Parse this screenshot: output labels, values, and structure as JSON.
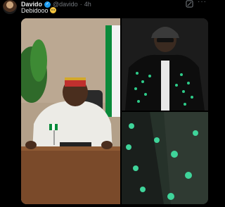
{
  "tweet": {
    "author_name": "Davido",
    "handle": "@davido",
    "separator": "·",
    "time": "4h",
    "text": "Debidooo",
    "emoji": "laughing-crying-emoji"
  },
  "colors": {
    "background": "#000000",
    "text": "#e7e9ea",
    "muted": "#71767b",
    "verified": "#1d9bf0"
  },
  "icons": {
    "verified": "verified-badge-icon",
    "grok": "grok-icon",
    "more": "more-icon"
  },
  "media": {
    "count": 3,
    "items": [
      "man-in-crown-at-desk-with-flag",
      "man-in-cap-and-studded-leather-jacket",
      "closeup-of-green-studded-jacket"
    ]
  }
}
